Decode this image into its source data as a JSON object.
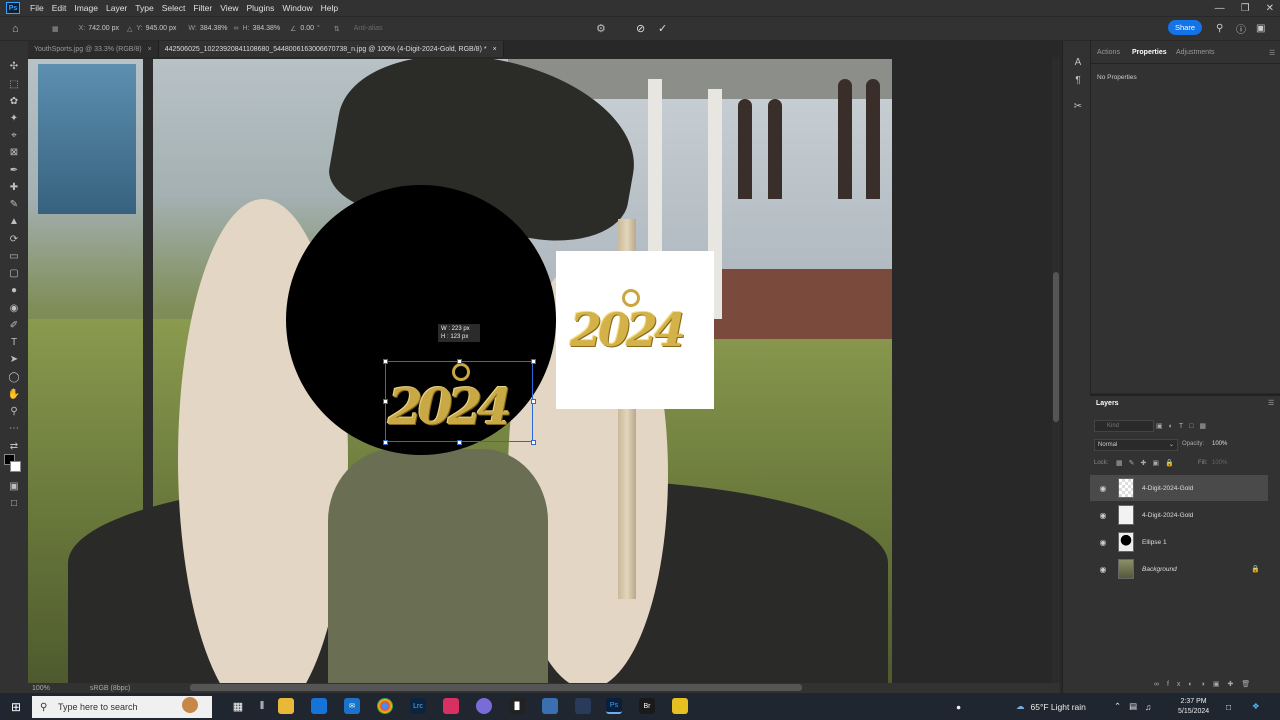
{
  "menu": {
    "app_icon": "Ps",
    "items": [
      "File",
      "Edit",
      "Image",
      "Layer",
      "Type",
      "Select",
      "Filter",
      "View",
      "Plugins",
      "Window",
      "Help"
    ]
  },
  "options_bar": {
    "x_label": "X:",
    "x_value": "742.00 px",
    "y_label": "Y:",
    "y_value": "945.00 px",
    "w_label": "W:",
    "w_value": "384.38%",
    "h_label": "H:",
    "h_value": "384.38%",
    "angle_value": "0.00",
    "angle_unit": "°",
    "antialias": "Anti-alias",
    "share": "Share"
  },
  "tabs": [
    {
      "label": "YouthSports.jpg @ 33.3% (RGB/8)",
      "close": "×",
      "active": false
    },
    {
      "label": "442506025_10223920841108680_5448006163006670738_n.jpg @ 100% (4-Digit-2024-Gold, RGB/8) *",
      "close": "×",
      "active": true
    }
  ],
  "canvas": {
    "artwork_text_1": "2024",
    "artwork_text_2": "2024",
    "transform_tip_w": "W :  223 px",
    "transform_tip_h": "H :  123 px"
  },
  "status": {
    "zoom": "100%",
    "profile": "sRGB (8bpc)"
  },
  "properties": {
    "tabs": [
      "Actions",
      "Properties",
      "Adjustments"
    ],
    "active_tab": "Properties",
    "content": "No Properties"
  },
  "layers": {
    "title": "Layers",
    "search_placeholder": "Kind",
    "blend_mode": "Normal",
    "opacity_label": "Opacity:",
    "opacity_value": "100%",
    "lock_label": "Lock:",
    "fill_label": "Fill:",
    "fill_value": "100%",
    "items": [
      {
        "name": "4-Digit-2024-Gold",
        "selected": true
      },
      {
        "name": "4-Digit-2024-Gold",
        "selected": false
      },
      {
        "name": "Ellipse 1",
        "selected": false
      },
      {
        "name": "Background",
        "selected": false
      }
    ]
  },
  "taskbar": {
    "search_placeholder": "Type here to search",
    "weather": "65°F  Light rain",
    "time": "2:37 PM",
    "date": "5/15/2024"
  },
  "colors": {
    "accent": "#1473e6",
    "selection": "#2a6ad8",
    "gold": "#d4b24a"
  }
}
